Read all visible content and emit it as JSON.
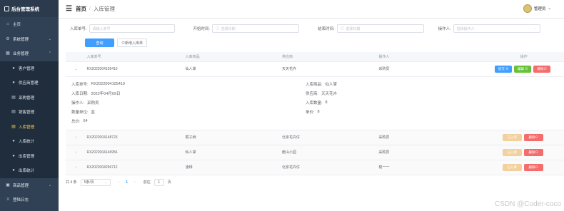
{
  "app": {
    "title": "后台管理系统"
  },
  "sidebar": {
    "items": [
      {
        "label": "主页",
        "icon": "home-icon",
        "type": "top"
      },
      {
        "label": "系统管理",
        "icon": "gear-icon",
        "type": "group"
      },
      {
        "label": "业务管理",
        "icon": "grid-icon",
        "type": "group"
      },
      {
        "label": "客户管理",
        "icon": "user-icon",
        "type": "sub"
      },
      {
        "label": "供应商管理",
        "icon": "user-icon",
        "type": "sub"
      },
      {
        "label": "采购管理",
        "icon": "cart-icon",
        "type": "sub"
      },
      {
        "label": "销售管理",
        "icon": "file-icon",
        "type": "sub"
      },
      {
        "label": "入库管理",
        "icon": "file-icon",
        "type": "sub",
        "active": true
      },
      {
        "label": "入库统计",
        "icon": "user-icon",
        "type": "sub"
      },
      {
        "label": "出库管理",
        "icon": "user-icon",
        "type": "sub"
      },
      {
        "label": "出库统计",
        "icon": "user-icon",
        "type": "sub"
      },
      {
        "label": "商品管理",
        "icon": "box-icon",
        "type": "group"
      },
      {
        "label": "登陆日志",
        "icon": "log-icon",
        "type": "top"
      }
    ]
  },
  "header": {
    "home": "首页",
    "sep": "/",
    "current": "入库管理",
    "user": "管理员",
    "user_caret": "⌄"
  },
  "filters": {
    "order_label": "入库单号:",
    "order_placeholder": "请输入单号",
    "start_label": "开始时间:",
    "start_placeholder": "选择日期",
    "end_label": "结束时间:",
    "end_placeholder": "选择日期",
    "operator_label": "操作人:",
    "operator_placeholder": "选择操作人"
  },
  "actions": {
    "search": "查询",
    "add": "⊙新增入库单"
  },
  "table": {
    "headers": [
      "入库单号",
      "入库商品",
      "供应商",
      "操作人",
      "操作"
    ],
    "rows": [
      {
        "id": "RX2022004105410",
        "product": "仙人掌",
        "supplier": "天天花卉",
        "operator": "采购员",
        "expanded": true,
        "buttons": [
          {
            "label": "提交 ⊘",
            "color": "#409eff"
          },
          {
            "label": "编辑 ⊘",
            "color": "#67c23a"
          },
          {
            "label": "删除⊙",
            "color": "#f56c6c"
          }
        ]
      },
      {
        "id": "RX2022004148723",
        "product": "栀子树",
        "supplier": "北京花卉仔",
        "operator": "采购员",
        "expanded": false,
        "buttons": [
          {
            "label": "已入库",
            "color": "#f3d19e"
          },
          {
            "label": "删除⊙",
            "color": "#f56c6c"
          }
        ]
      },
      {
        "id": "RX2022004146956",
        "product": "仙人掌",
        "supplier": "鲍山小园",
        "operator": "采购员",
        "expanded": false,
        "buttons": [
          {
            "label": "已入库",
            "color": "#f3d19e"
          },
          {
            "label": "删除⊙",
            "color": "#f56c6c"
          }
        ]
      },
      {
        "id": "RX2022004296712",
        "product": "凌绿",
        "supplier": "北京花卉仔",
        "operator": "梭一一",
        "expanded": false,
        "buttons": [
          {
            "label": "已入库",
            "color": "#f3d19e"
          },
          {
            "label": "删除⊙",
            "color": "#f56c6c"
          }
        ]
      }
    ],
    "detail": {
      "order_no_label": "入库单号:",
      "order_no": "RX2022004105410",
      "product_label": "入库商品:",
      "product": "仙人掌",
      "date_label": "入库日期:",
      "date": "2022年04月09日",
      "supplier_label": "供应商:",
      "supplier": "天天花卉",
      "operator_label": "操作人:",
      "operator": "采购员",
      "qty_label": "入库数量:",
      "qty": "8",
      "unit_label": "数量单位:",
      "unit": "盆",
      "price_label": "单价:",
      "price": "8",
      "total_label": "总价:",
      "total": "64"
    }
  },
  "pager": {
    "total": "共 4 条",
    "page_size": "5条/页",
    "prev": "‹",
    "page": "1",
    "next": "›",
    "goto": "前往",
    "goto_value": "1",
    "page_unit": "页"
  },
  "watermark": "CSDN @Coder-coco"
}
